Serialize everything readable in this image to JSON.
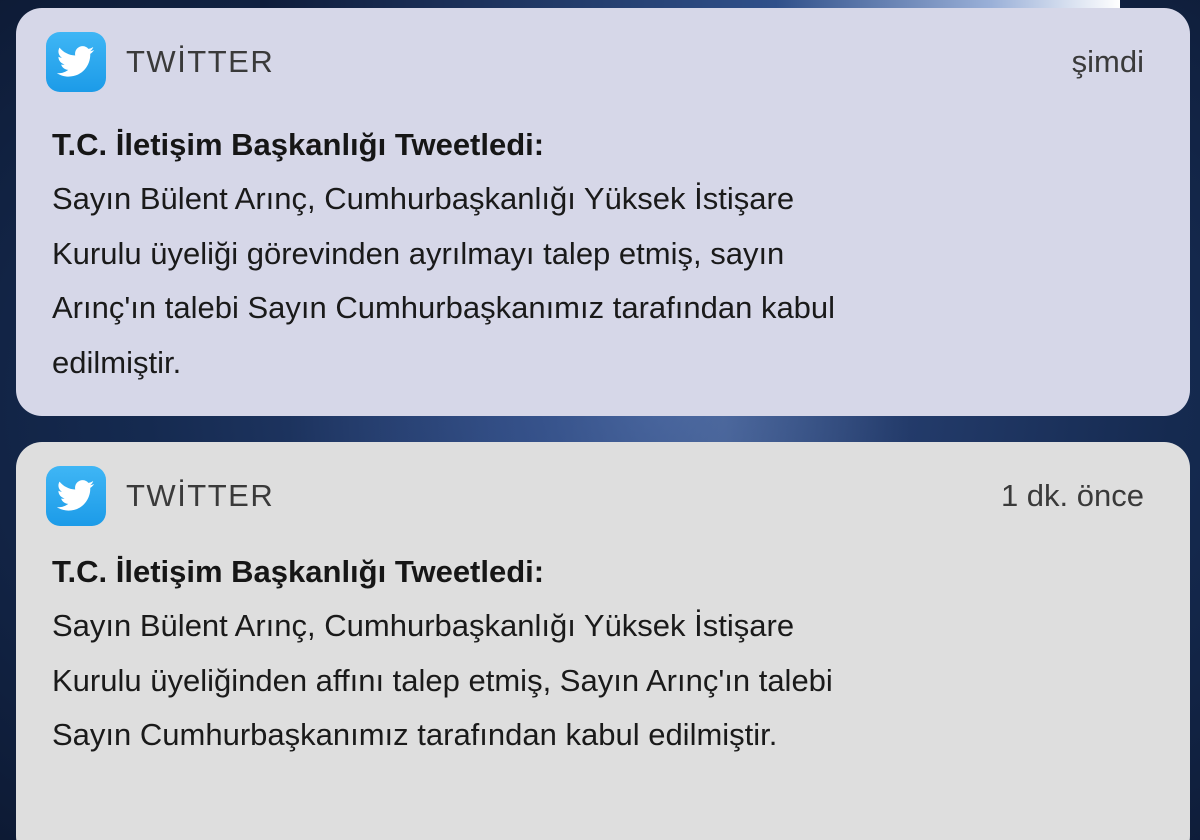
{
  "notifications": [
    {
      "app": "TWİTTER",
      "time": "şimdi",
      "title": "T.C. İletişim Başkanlığı Tweetledi:",
      "lines": [
        "Sayın Bülent Arınç, Cumhurbaşkanlığı Yüksek İstişare",
        "Kurulu üyeliği görevinden ayrılmayı talep etmiş, sayın",
        "Arınç'ın talebi Sayın Cumhurbaşkanımız tarafından kabul",
        "edilmiştir."
      ]
    },
    {
      "app": "TWİTTER",
      "time": "1 dk. önce",
      "title": "T.C. İletişim Başkanlığı Tweetledi:",
      "lines": [
        "Sayın Bülent Arınç, Cumhurbaşkanlığı Yüksek İstişare",
        "Kurulu üyeliğinden affını talep etmiş, Sayın Arınç'ın talebi",
        "Sayın Cumhurbaşkanımız tarafından kabul edilmiştir."
      ]
    }
  ],
  "icon": "twitter-bird-icon",
  "colors": {
    "twitter_blue": "#1da1f2",
    "card_1_bg": "#d6d7e8",
    "card_2_bg": "#dedede"
  }
}
